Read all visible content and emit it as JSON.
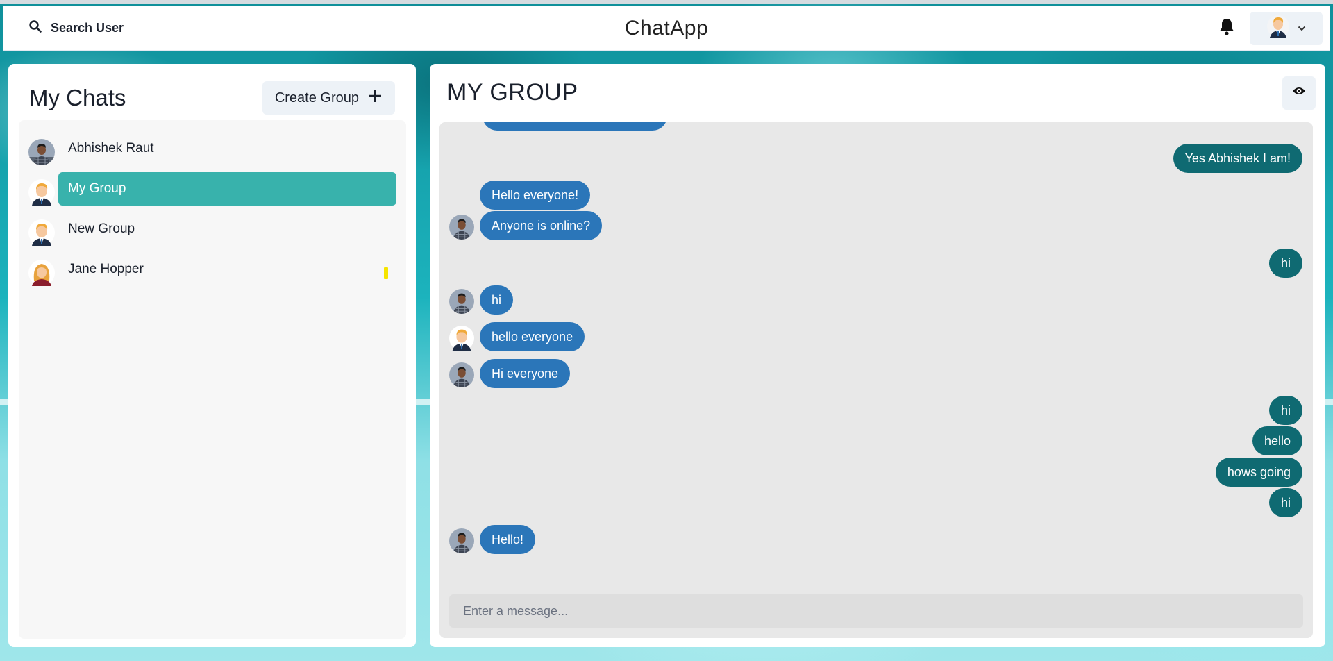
{
  "header": {
    "search_label": "Search User",
    "app_title": "ChatApp",
    "icons": {
      "search": "search-icon",
      "bell": "bell-icon",
      "profile_chevron": "chevron-down-icon"
    }
  },
  "sidebar": {
    "title": "My Chats",
    "create_group_label": "Create Group",
    "create_group_icon": "plus-icon",
    "chats": [
      {
        "name": "Abhishek Raut",
        "avatar": "photo-avatar",
        "active": false
      },
      {
        "name": "My Group",
        "avatar": "cartoon-man-avatar",
        "active": true
      },
      {
        "name": "New Group",
        "avatar": "cartoon-man-avatar",
        "active": false
      },
      {
        "name": "Jane Hopper",
        "avatar": "cartoon-woman-avatar",
        "active": false,
        "unread_marker_color": "#f5e400"
      }
    ]
  },
  "chat": {
    "title": "MY GROUP",
    "eye_icon": "eye-icon",
    "messages": [
      {
        "text": "Yes Abhishek I am!",
        "sender": "me"
      },
      {
        "text": "Hello everyone!",
        "sender": "Abhishek Raut"
      },
      {
        "text": "Anyone is online?",
        "sender": "Abhishek Raut"
      },
      {
        "text": "hi",
        "sender": "me"
      },
      {
        "text": "hi",
        "sender": "Abhishek Raut"
      },
      {
        "text": "hello everyone",
        "sender": "New Group"
      },
      {
        "text": "Hi everyone",
        "sender": "Abhishek Raut"
      },
      {
        "text": "hi",
        "sender": "me"
      },
      {
        "text": "hello",
        "sender": "me"
      },
      {
        "text": "hows going",
        "sender": "me"
      },
      {
        "text": "hi",
        "sender": "me"
      },
      {
        "text": "Hello!",
        "sender": "Abhishek Raut"
      }
    ],
    "input_placeholder": "Enter a message..."
  },
  "colors": {
    "active_chat": "#38b2ac",
    "incoming_bubble": "#2b76b9",
    "outgoing_bubble": "#0f6a72",
    "chat_background": "#e8e8e8"
  }
}
